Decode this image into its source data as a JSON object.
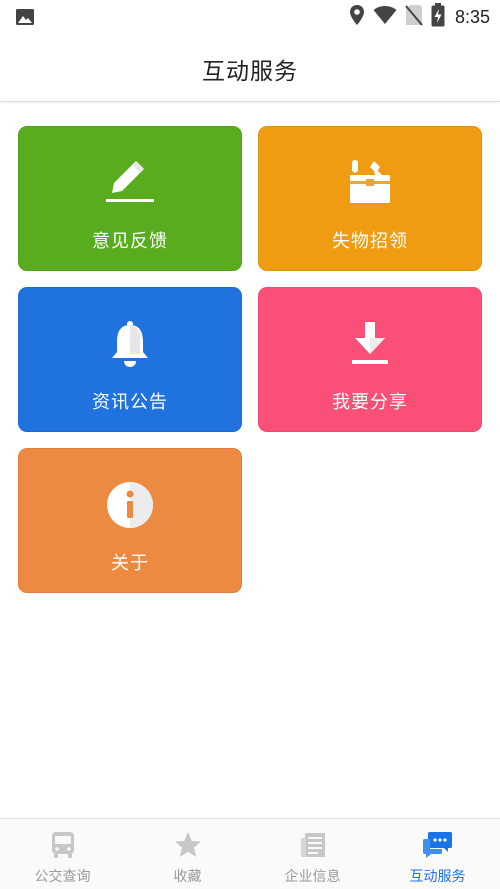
{
  "status_bar": {
    "time": "8:35",
    "icons": [
      "image-icon",
      "location-icon",
      "wifi-icon",
      "no-sim-icon",
      "battery-charging-icon"
    ]
  },
  "header": {
    "title": "互动服务"
  },
  "tiles": [
    {
      "label": "意见反馈",
      "icon": "pencil-icon",
      "color": "#5aac1f"
    },
    {
      "label": "失物招领",
      "icon": "toolbox-icon",
      "color": "#ef9c12"
    },
    {
      "label": "资讯公告",
      "icon": "bell-icon",
      "color": "#2072de"
    },
    {
      "label": "我要分享",
      "icon": "download-icon",
      "color": "#fa5077"
    },
    {
      "label": "关于",
      "icon": "info-icon",
      "color": "#ed8a42"
    }
  ],
  "tabbar": {
    "items": [
      {
        "label": "公交查询",
        "icon": "bus-icon",
        "active": false
      },
      {
        "label": "收藏",
        "icon": "star-icon",
        "active": false
      },
      {
        "label": "企业信息",
        "icon": "newspaper-icon",
        "active": false
      },
      {
        "label": "互动服务",
        "icon": "chat-bubbles-icon",
        "active": true
      }
    ],
    "active_color": "#1a73e8",
    "inactive_color": "#9a9a9a"
  }
}
